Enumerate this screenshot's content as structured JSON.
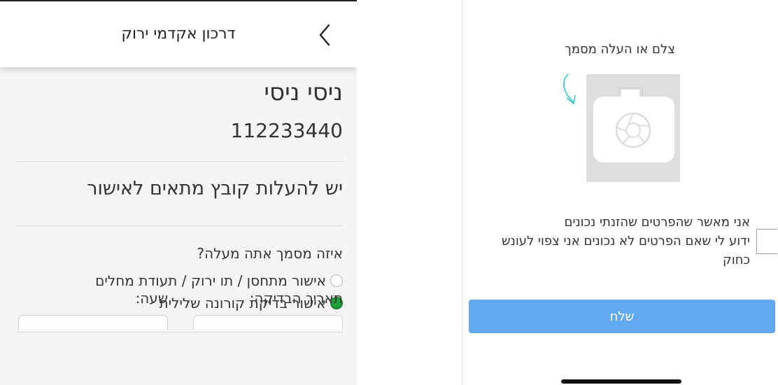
{
  "left_screen": {
    "header": {
      "title": "דרכון אקדמי ירוק",
      "back_icon": "chevron-left-icon"
    },
    "user": {
      "name": "ניסי ניסי",
      "id_number": "112233440"
    },
    "upload_message": "יש להעלות קובץ מתאים לאישור",
    "document_question": "איזה מסמך אתה מעלה?",
    "options": [
      {
        "label": "אישור מתחסן / תו ירוק / תעודת מחלים",
        "selected": false
      },
      {
        "label": "אישור בדיקת קורונה שלילית",
        "selected": true
      }
    ],
    "test_date_label": "תאריך הבדיקה:",
    "time_label": "שעה:",
    "colors": {
      "selected_radio": "#1ea33c",
      "background": "#f5f5f5"
    }
  },
  "right_screen": {
    "title": "צלם או העלה מסמך",
    "camera_icon": "camera-icon",
    "rotate_icon": "rotate-arrow-icon",
    "consent_lines": [
      "אני מאשר שהפרטים שהזנתי נכונים",
      "ידוע לי שאם הפרטים לא נכונים אני צפוי לעונש",
      "כחוק"
    ],
    "consent_checked": false,
    "send_label": "שלח",
    "colors": {
      "send_button": "#61a9f0",
      "rotate_arrow": "#3cc5d8"
    }
  }
}
